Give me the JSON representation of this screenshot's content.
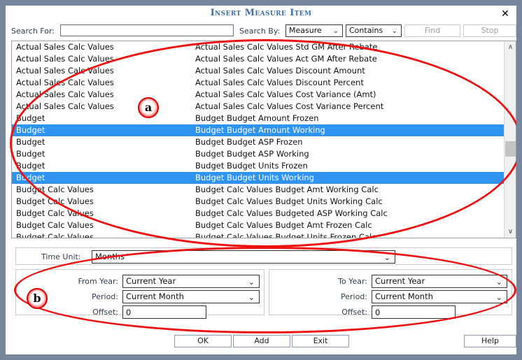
{
  "window": {
    "title": "Insert Measure Item",
    "close_icon": "close-icon",
    "close_glyph": "✕"
  },
  "search": {
    "search_for_label": "Search For:",
    "search_for_value": "",
    "search_for_placeholder": "",
    "search_by_label": "Search By:",
    "field_select": "Measure",
    "operator_select": "Contains",
    "find_button": "Find",
    "stop_button": "Stop",
    "caret_glyph": "⌄"
  },
  "list": {
    "selected_color": "#2f93f0",
    "scroll_up_glyph": "∧",
    "scroll_down_glyph": "∨",
    "rows": [
      {
        "group": "Actual Sales Calc Values",
        "measure": "Actual Sales Calc Values Std GM After Rebate",
        "selected": false
      },
      {
        "group": "Actual Sales Calc Values",
        "measure": "Actual Sales Calc Values Act GM After Rebate",
        "selected": false
      },
      {
        "group": "Actual Sales Calc Values",
        "measure": "Actual Sales Calc Values Discount Amount",
        "selected": false
      },
      {
        "group": "Actual Sales Calc Values",
        "measure": "Actual Sales Calc Values Discount Percent",
        "selected": false
      },
      {
        "group": "Actual Sales Calc Values",
        "measure": "Actual Sales Calc Values Cost Variance (Amt)",
        "selected": false
      },
      {
        "group": "Actual Sales Calc Values",
        "measure": "Actual Sales Calc Values Cost Variance Percent",
        "selected": false
      },
      {
        "group": "Budget",
        "measure": "Budget Budget Amount Frozen",
        "selected": false
      },
      {
        "group": "Budget",
        "measure": "Budget Budget Amount Working",
        "selected": true
      },
      {
        "group": "Budget",
        "measure": "Budget Budget ASP Frozen",
        "selected": false
      },
      {
        "group": "Budget",
        "measure": "Budget Budget ASP Working",
        "selected": false
      },
      {
        "group": "Budget",
        "measure": "Budget Budget Units Frozen",
        "selected": false
      },
      {
        "group": "Budget",
        "measure": "Budget Budget Units Working",
        "selected": true
      },
      {
        "group": "Budget Calc Values",
        "measure": "Budget Calc Values Budget Amt Working Calc",
        "selected": false
      },
      {
        "group": "Budget Calc Values",
        "measure": "Budget Calc Values Budget Units Working Calc",
        "selected": false
      },
      {
        "group": "Budget Calc Values",
        "measure": "Budget Calc Values Budgeted ASP Working Calc",
        "selected": false
      },
      {
        "group": "Budget Calc Values",
        "measure": "Budget Calc Values Budget Amt Frozen Calc",
        "selected": false
      },
      {
        "group": "Budget Calc Values",
        "measure": "Budget Calc Values Budget Units Frozen Calc",
        "selected": false
      }
    ]
  },
  "time": {
    "time_unit_label": "Time Unit:",
    "time_unit_value": "Months",
    "from": {
      "year_label": "From Year:",
      "year_value": "Current Year",
      "period_label": "Period:",
      "period_value": "Current Month",
      "offset_label": "Offset:",
      "offset_value": "0"
    },
    "to": {
      "year_label": "To Year:",
      "year_value": "Current Year",
      "period_label": "Period:",
      "period_value": "Current Month",
      "offset_label": "Offset:",
      "offset_value": "0"
    },
    "caret_glyph": "⌄"
  },
  "footer": {
    "ok": "OK",
    "add": "Add",
    "exit": "Exit",
    "help": "Help"
  },
  "annotations": {
    "marker_a": "a",
    "marker_b": "b",
    "color": "#ee1111"
  }
}
